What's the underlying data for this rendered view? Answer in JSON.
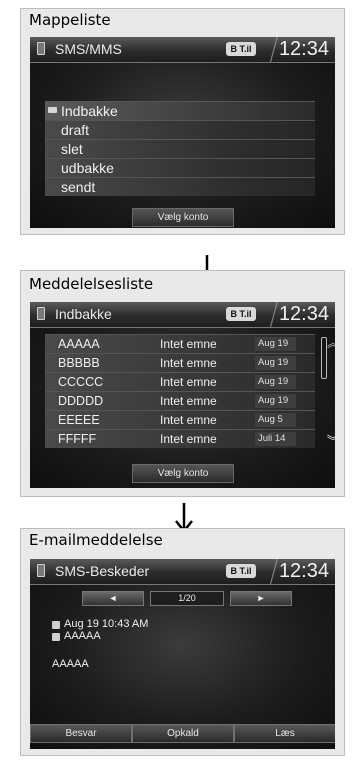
{
  "panel1": {
    "heading": "Mappeliste",
    "title": "SMS/MMS",
    "bt": "B T.il",
    "clock": "12:34",
    "folders": [
      "Indbakke",
      "draft",
      "slet",
      "udbakke",
      "sendt"
    ],
    "select_account": "Vælg konto"
  },
  "panel2": {
    "heading": "Meddelelsesliste",
    "title": "Indbakke",
    "bt": "B T.il",
    "clock": "12:34",
    "messages": [
      {
        "sender": "AAAAA",
        "subject": "Intet emne",
        "date": "Aug 19"
      },
      {
        "sender": "BBBBB",
        "subject": "Intet emne",
        "date": "Aug 19"
      },
      {
        "sender": "CCCCC",
        "subject": "Intet emne",
        "date": "Aug 19"
      },
      {
        "sender": "DDDDD",
        "subject": "Intet emne",
        "date": "Aug 19"
      },
      {
        "sender": "EEEEE",
        "subject": "Intet emne",
        "date": "Aug  5"
      },
      {
        "sender": "FFFFF",
        "subject": "Intet emne",
        "date": "Juli 14"
      }
    ],
    "select_account": "Vælg konto"
  },
  "panel3": {
    "heading": "E-mailmeddelelse",
    "title": "SMS-Beskeder",
    "bt": "B T.il",
    "clock": "12:34",
    "prev": "◄",
    "counter": "1/20",
    "next": "►",
    "timestamp": "Aug 19 10:43 AM",
    "from": "AAAAA",
    "body": "AAAAA",
    "actions": [
      "Besvar",
      "Opkald",
      "Læs"
    ]
  },
  "icons": [
    "phone-icon",
    "envelope-icon",
    "bluetooth-signal-icon",
    "scroll-up-icon",
    "scroll-down-icon",
    "down-arrow-icon",
    "calendar-icon",
    "contact-icon"
  ]
}
